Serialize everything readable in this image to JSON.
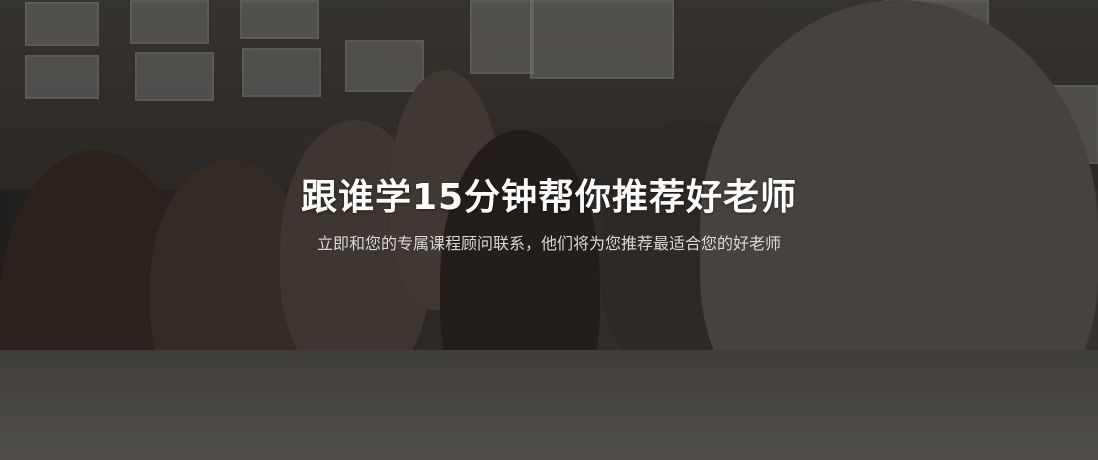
{
  "banner": {
    "title": "跟谁学15分钟帮你推荐好老师",
    "subtitle": "立即和您的专属课程顾问联系，他们将为您推荐最适合您的好老师",
    "background_image": "classroom-teacher-children-photo",
    "overlay_color": "#000000"
  }
}
